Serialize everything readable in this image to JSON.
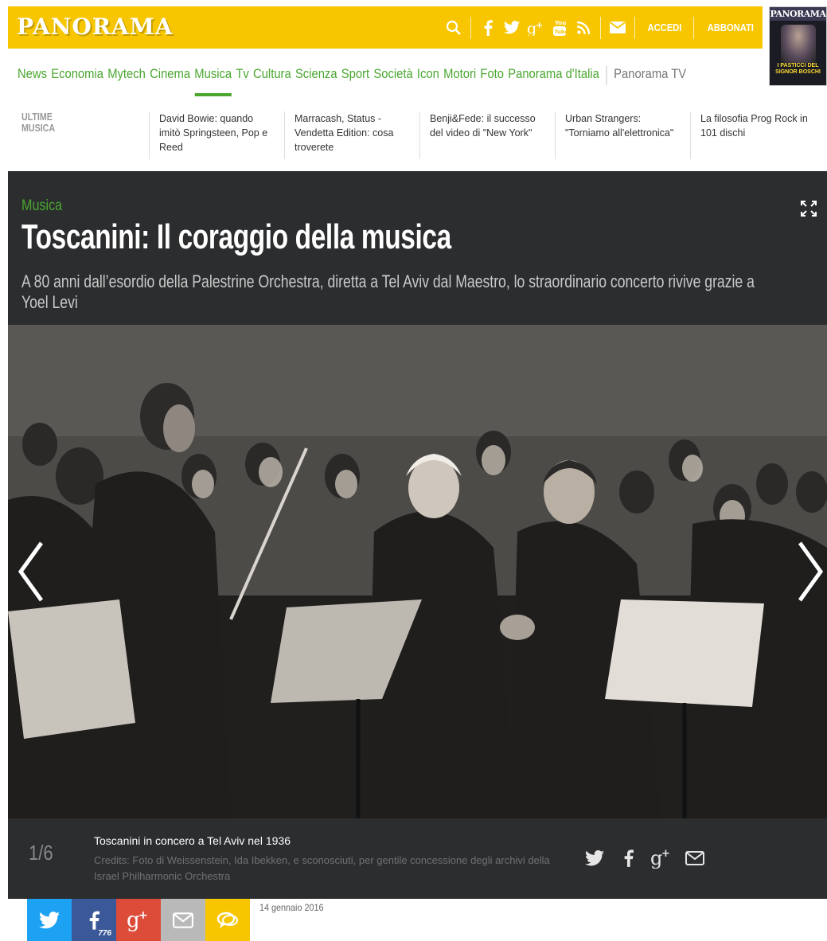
{
  "brand": {
    "logo": "PANORAMA",
    "accent": "#f7c600",
    "green": "#4aa62f"
  },
  "topbar": {
    "icons": [
      "search-icon",
      "facebook-icon",
      "twitter-icon",
      "google-plus-icon",
      "youtube-icon",
      "rss-icon",
      "mail-icon"
    ],
    "login_label": "ACCEDI",
    "subscribe_label": "ABBONATI"
  },
  "cover": {
    "title": "PANORAMA",
    "headline": "I PASTICCI DEL SIGNOR BOSCHI"
  },
  "nav": {
    "items": [
      "News",
      "Economia",
      "Mytech",
      "Cinema",
      "Musica",
      "Tv",
      "Cultura",
      "Scienza",
      "Sport",
      "Società",
      "Icon",
      "Motori",
      "Foto",
      "Panorama d'Italia"
    ],
    "active": "Musica",
    "extra": "Panorama TV"
  },
  "latest": {
    "heading_line1": "ULTIME",
    "heading_line2": "MUSICA",
    "items": [
      "David Bowie: quando imitò Springsteen, Pop e Reed",
      "Marracash, Status - Vendetta Edition: cosa troverete",
      "Benji&Fede: il successo del video di \"New York\"",
      "Urban Strangers: \"Torniamo all'elettronica\"",
      "La filosofia Prog Rock in 101 dischi"
    ]
  },
  "article": {
    "kicker": "Musica",
    "title": "Toscanini: Il coraggio della musica",
    "subtitle": "A 80 anni dall’esordio della Palestrine Orchestra, diretta a Tel Aviv dal Maestro, lo straordinario concerto rivive grazie a Yoel Levi",
    "date": "14 gennaio 2016"
  },
  "gallery": {
    "counter": "1/6",
    "caption": "Toscanini in concero a Tel Aviv nel 1936",
    "credit": "Credits: Foto di Weissenstein, Ida Ibekken, e sconosciuti, per gentile concessione degli archivi della Israel Philharmonic Orchestra",
    "share_icons": [
      "twitter-icon",
      "facebook-icon",
      "google-plus-icon",
      "mail-icon"
    ]
  },
  "share_bar": {
    "buttons": [
      {
        "name": "twitter",
        "color": "#1da1f2"
      },
      {
        "name": "facebook",
        "color": "#3b5998"
      },
      {
        "name": "google-plus",
        "color": "#dd4b39"
      },
      {
        "name": "mail",
        "color": "#b9b9b9"
      },
      {
        "name": "comments",
        "color": "#f7c600"
      }
    ],
    "facebook_count": "776"
  }
}
